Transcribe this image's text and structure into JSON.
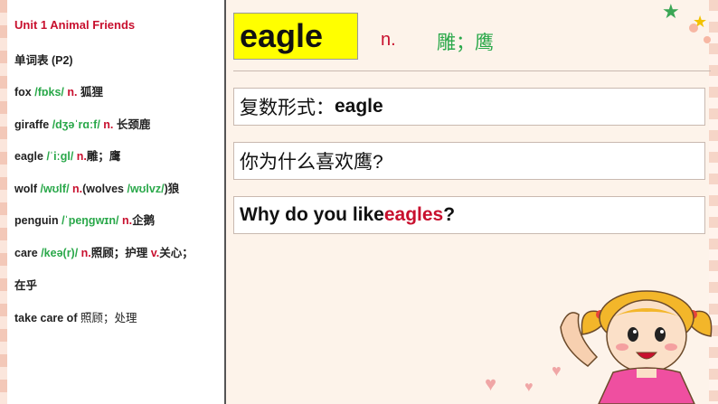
{
  "vocab": {
    "title": "Unit 1  Animal Friends",
    "subtitle": "单词表 (P2)",
    "entries": [
      {
        "word": "fox ",
        "phon": "/fɒks/",
        "pos": " n.",
        "meaning": "  狐狸"
      },
      {
        "word": "giraffe ",
        "phon": "/dʒəˈrɑːf/",
        "pos": " n.",
        "meaning": "  长颈鹿"
      },
      {
        "word": "eagle ",
        "phon": "/ˈiːɡl/",
        "pos": " n.",
        "meaning": "雕；鹰"
      },
      {
        "word": "wolf ",
        "phon": "/wʊlf/",
        "pos": " n.",
        "meaning": "(wolves ",
        "phon2": "/wʊlvz/",
        "meaning2": ")狼"
      },
      {
        "word": "penguin ",
        "phon": "/ˈpeŋɡwɪn/",
        "pos": " n.",
        "meaning": "企鹅"
      },
      {
        "word": "care ",
        "phon": "/keə(r)/",
        "pos": " n.",
        "meaning": "照顾；护理 ",
        "pos2": "v.",
        "meaning2": "关心；"
      },
      {
        "continuation": "在乎"
      },
      {
        "phrase": "take care of",
        "meaning": " 照顾；处理"
      }
    ]
  },
  "slide": {
    "word": "eagle",
    "pos": "n.",
    "meaning": "雕；鹰",
    "plural_label": "复数形式：",
    "plural_value": "eagle",
    "question_cn": "你为什么喜欢鹰?",
    "question_en_prefix": "Why do you like ",
    "question_en_highlight": "eagles",
    "question_en_suffix": "?"
  },
  "colors": {
    "highlight": "#ffff00",
    "red": "#c8102e",
    "green": "#2aa84a"
  }
}
